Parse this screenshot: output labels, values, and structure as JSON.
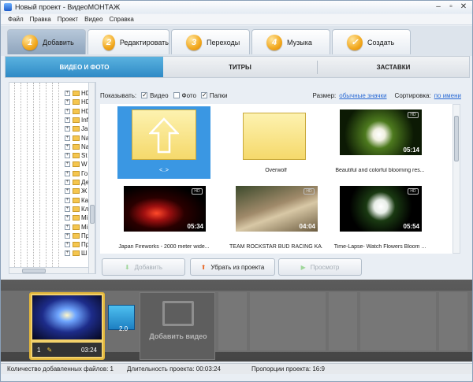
{
  "window": {
    "title": "Новый проект - ВидеоМОНТАЖ"
  },
  "menu": [
    "Файл",
    "Правка",
    "Проект",
    "Видео",
    "Справка"
  ],
  "steps": [
    {
      "num": "1",
      "label": "Добавить",
      "active": true
    },
    {
      "num": "2",
      "label": "Редактировать",
      "active": false
    },
    {
      "num": "3",
      "label": "Переходы",
      "active": false
    },
    {
      "num": "4",
      "label": "Музыка",
      "active": false
    },
    {
      "num": "",
      "label": "Создать",
      "active": false
    }
  ],
  "subtabs": [
    "ВИДЕО И ФОТО",
    "ТИТРЫ",
    "ЗАСТАВКИ"
  ],
  "folders": [
    "HD",
    "HD",
    "HD",
    "Inf",
    "Ja",
    "Na",
    "Na",
    "St",
    "W",
    "Го",
    "Де",
    "Ж",
    "Ка",
    "Кл",
    "Mi",
    "Mi",
    "Пр",
    "Пр",
    "Ш"
  ],
  "filter": {
    "show_label": "Показывать:",
    "video_label": "Видео",
    "video_checked": "✓",
    "photo_label": "Фото",
    "photo_checked": "",
    "folders_label": "Папки",
    "folders_checked": "✓",
    "size_label": "Размер:",
    "size_value": "обычные значки",
    "sort_label": "Сортировка:",
    "sort_value": "по имени"
  },
  "grid": [
    {
      "caption": "<..>",
      "kind": "up",
      "duration": ""
    },
    {
      "caption": "Overwolf",
      "kind": "folder",
      "duration": ""
    },
    {
      "caption": "Beautiful and colorful blooming res...",
      "kind": "video",
      "duration": "05:14"
    },
    {
      "caption": "Japan Fireworks - 2000 meter wide...",
      "kind": "video",
      "duration": "05:34"
    },
    {
      "caption": "TEAM ROCKSTAR BUD RACING KA...",
      "kind": "video",
      "duration": "04:04"
    },
    {
      "caption": "Time-Lapse- Watch Flowers Bloom ...",
      "kind": "video",
      "duration": "05:54"
    }
  ],
  "buttons": {
    "add": "Добавить",
    "remove": "Убрать из проекта",
    "preview": "Просмотр"
  },
  "timeline": {
    "clip_index": "1",
    "clip_duration": "03:24",
    "transition": "2.0",
    "add_video": "Добавить видео"
  },
  "status": {
    "files": "Количество добавленных файлов: 1",
    "duration": "Длительность проекта: 00:03:24",
    "ratio": "Пропорции проекта: 16:9"
  },
  "colors": {
    "accent": "#3a97e3",
    "step_badge": "#f2a81e",
    "subtab_active": "#2f8ac6"
  }
}
